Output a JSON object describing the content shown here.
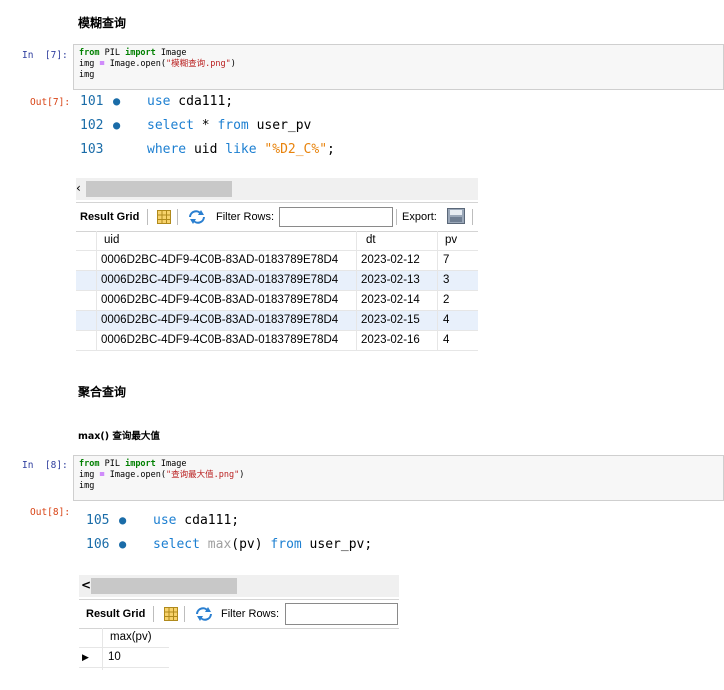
{
  "sections": {
    "fuzzy_title": "模糊查询",
    "agg_title": "聚合查询",
    "max_title": "max() 查询最大值"
  },
  "cell7": {
    "in_prompt": "In  [7]:",
    "out_prompt": "Out[7]:",
    "code": {
      "l1_kw1": "from",
      "l1_mod": " PIL ",
      "l1_kw2": "import",
      "l1_name": " Image",
      "l2_pre": "img ",
      "l2_op": "=",
      "l2_mid": " Image.open(",
      "l2_str": "\"模糊查询.png\"",
      "l2_end": ")",
      "l3": "img"
    },
    "sql": [
      {
        "num": "101",
        "dot": "●",
        "parts": [
          {
            "t": "use",
            "c": "skw"
          },
          {
            "t": " cda111;",
            "c": ""
          }
        ]
      },
      {
        "num": "102",
        "dot": "●",
        "parts": [
          {
            "t": "select",
            "c": "skw"
          },
          {
            "t": " * ",
            "c": ""
          },
          {
            "t": "from",
            "c": "skw"
          },
          {
            "t": " user_pv",
            "c": ""
          }
        ]
      },
      {
        "num": "103",
        "dot": "",
        "parts": [
          {
            "t": "where",
            "c": "skw"
          },
          {
            "t": " uid ",
            "c": ""
          },
          {
            "t": "like",
            "c": "skw"
          },
          {
            "t": " ",
            "c": ""
          },
          {
            "t": "\"%D2_C%\"",
            "c": "sstr"
          },
          {
            "t": ";",
            "c": ""
          }
        ]
      }
    ],
    "grid": {
      "scroll_arrow": "‹",
      "result_grid": "Result Grid",
      "filter_rows": "Filter Rows:",
      "export": "Export:",
      "headers": [
        "uid",
        "dt",
        "pv"
      ],
      "rows": [
        [
          "0006D2BC-4DF9-4C0B-83AD-0183789E78D4",
          "2023-02-12",
          "7"
        ],
        [
          "0006D2BC-4DF9-4C0B-83AD-0183789E78D4",
          "2023-02-13",
          "3"
        ],
        [
          "0006D2BC-4DF9-4C0B-83AD-0183789E78D4",
          "2023-02-14",
          "2"
        ],
        [
          "0006D2BC-4DF9-4C0B-83AD-0183789E78D4",
          "2023-02-15",
          "4"
        ],
        [
          "0006D2BC-4DF9-4C0B-83AD-0183789E78D4",
          "2023-02-16",
          "4"
        ]
      ]
    }
  },
  "cell8": {
    "in_prompt": "In  [8]:",
    "out_prompt": "Out[8]:",
    "code": {
      "l1_kw1": "from",
      "l1_mod": " PIL ",
      "l1_kw2": "import",
      "l1_name": " Image",
      "l2_pre": "img ",
      "l2_op": "=",
      "l2_mid": " Image.open(",
      "l2_str": "\"查询最大值.png\"",
      "l2_end": ")",
      "l3": "img"
    },
    "sql": [
      {
        "num": "105",
        "dot": "●",
        "parts": [
          {
            "t": "use",
            "c": "skw"
          },
          {
            "t": " cda111;",
            "c": ""
          }
        ]
      },
      {
        "num": "106",
        "dot": "●",
        "parts": [
          {
            "t": "select",
            "c": "skw"
          },
          {
            "t": " ",
            "c": ""
          },
          {
            "t": "max",
            "c": "sfn"
          },
          {
            "t": "(pv) ",
            "c": ""
          },
          {
            "t": "from",
            "c": "skw"
          },
          {
            "t": " user_pv;",
            "c": ""
          }
        ]
      }
    ],
    "grid": {
      "scroll_arrow": "<",
      "result_grid": "Result Grid",
      "filter_rows": "Filter Rows:",
      "headers": [
        "max(pv)"
      ],
      "row_marker": "▶",
      "rows": [
        [
          "10"
        ]
      ]
    }
  },
  "colors": {
    "in_prompt": "#303f9f",
    "out_prompt": "#d84315",
    "sql_keyword": "#1c7fd1",
    "sql_string": "#e8830c",
    "line_number": "#1a6ca8",
    "row_highlight": "#e8f0fb"
  }
}
